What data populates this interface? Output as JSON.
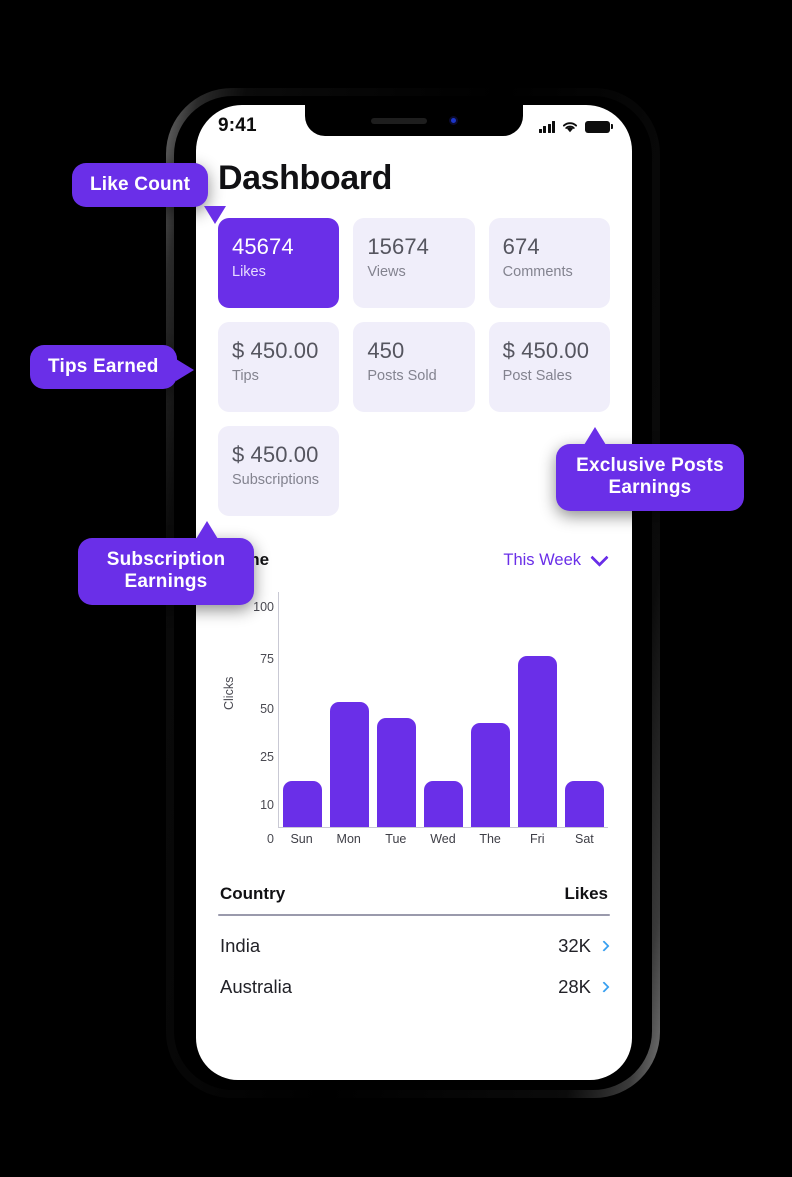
{
  "status_bar": {
    "time": "9:41",
    "signal_icon": "cellular-signal-icon",
    "wifi_icon": "wifi-icon",
    "battery_icon": "battery-icon"
  },
  "header": {
    "title": "Dashboard"
  },
  "colors": {
    "accent": "#6A2FE8",
    "card_bg": "#F0EEFA",
    "chevron_blue": "#39A0F0",
    "screen_bg": "#FFFFFF"
  },
  "stats": [
    {
      "value": "45674",
      "label": "Likes",
      "highlighted": true
    },
    {
      "value": "15674",
      "label": "Views",
      "highlighted": false
    },
    {
      "value": "674",
      "label": "Comments",
      "highlighted": false
    },
    {
      "value": "$ 450.00",
      "label": "Tips",
      "highlighted": false
    },
    {
      "value": "450",
      "label": "Posts Sold",
      "highlighted": false
    },
    {
      "value": "$ 450.00",
      "label": "Post Sales",
      "highlighted": false
    },
    {
      "value": "$ 450.00",
      "label": "Subscriptions",
      "highlighted": false
    }
  ],
  "chart_section": {
    "title": "Frame",
    "timeframe_value": "This Week",
    "dropdown_icon": "chevron-down-icon"
  },
  "chart_data": {
    "type": "bar",
    "title": "Frame",
    "xlabel": "",
    "ylabel": "Clicks",
    "categories": [
      "Sun",
      "Mon",
      "Tue",
      "Wed",
      "The",
      "Fri",
      "Sat"
    ],
    "values": [
      17,
      53,
      45,
      17,
      42,
      76,
      17
    ],
    "ytick_labels": [
      "0",
      "10",
      "25",
      "50",
      "75",
      "100"
    ],
    "ytick_values": [
      0,
      10,
      25,
      50,
      75,
      100
    ],
    "ytick_positions_pct": [
      0,
      9.9,
      30.2,
      50.4,
      71.5,
      93.8
    ],
    "ylim": [
      0,
      106
    ],
    "grid": false,
    "legend": "none",
    "bar_color": "#6A2FE8"
  },
  "country_table": {
    "columns": [
      "Country",
      "Likes"
    ],
    "rows": [
      {
        "country": "India",
        "likes": "32K",
        "chevron_icon": "chevron-right-icon"
      },
      {
        "country": "Australia",
        "likes": "28K",
        "chevron_icon": "chevron-right-icon"
      }
    ]
  },
  "callouts": [
    {
      "id": "like-count",
      "text": "Like Count",
      "tail": "down"
    },
    {
      "id": "tips-earned",
      "text": "Tips Earned",
      "tail": "right"
    },
    {
      "id": "exclusive",
      "text": "Exclusive Posts Earnings",
      "tail": "up"
    },
    {
      "id": "subscription",
      "text": "Subscription Earnings",
      "tail": "up"
    }
  ]
}
